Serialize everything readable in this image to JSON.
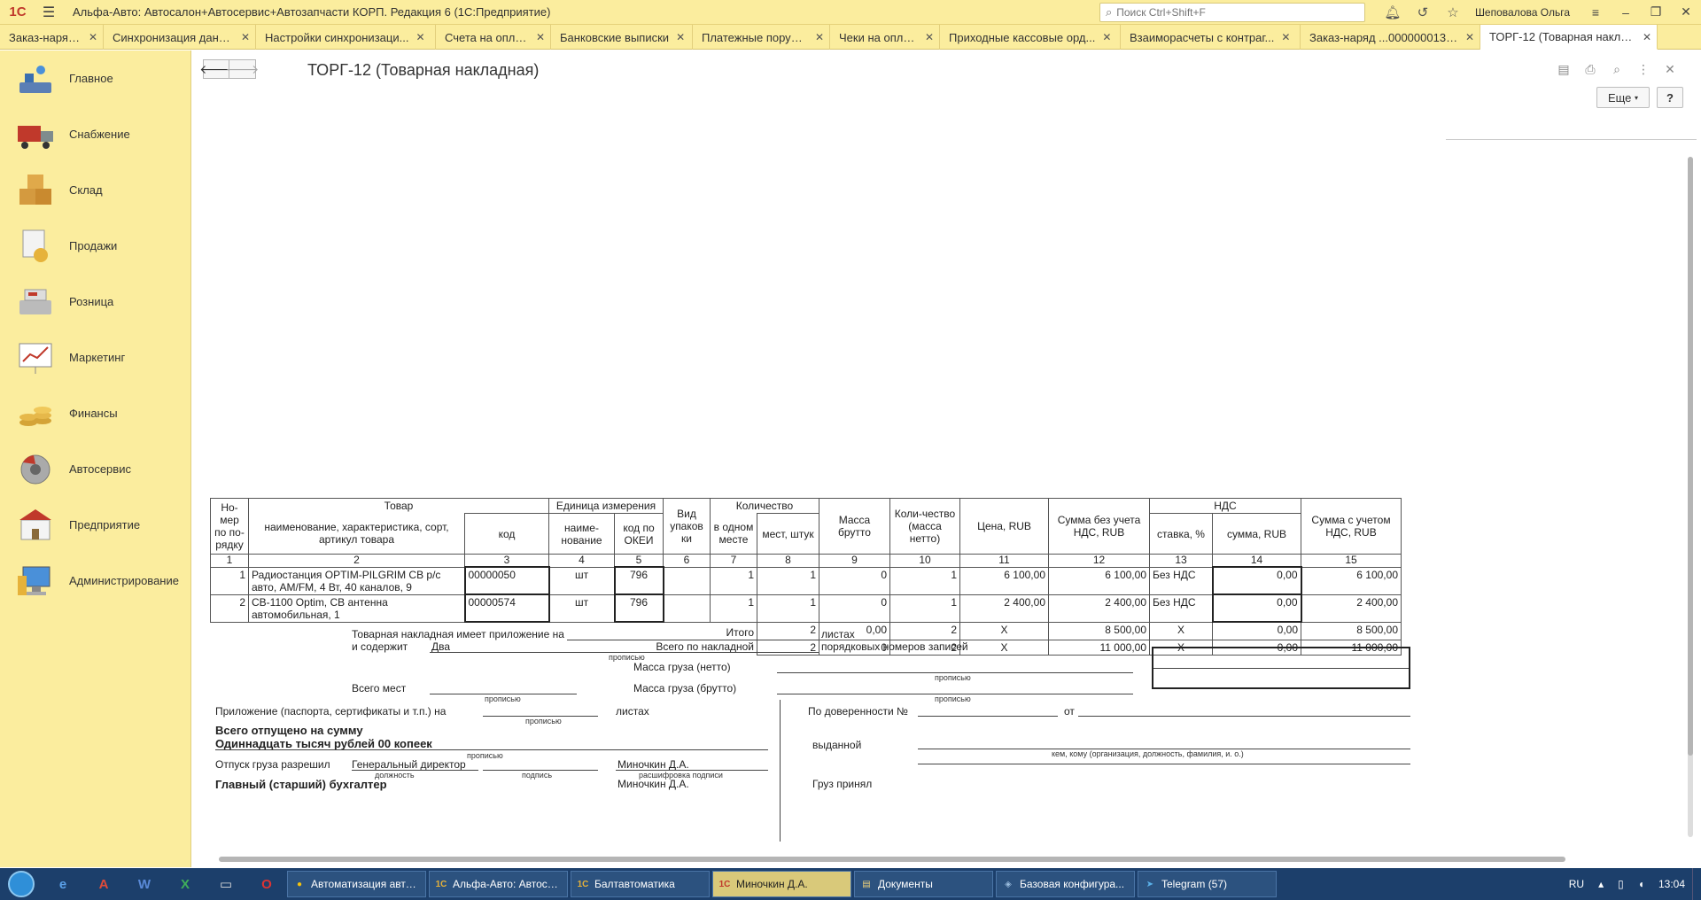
{
  "titlebar": {
    "logo": "1С",
    "title": "Альфа-Авто: Автосалон+Автосервис+Автозапчасти КОРП. Редакция 6  (1С:Предприятие)",
    "search_placeholder": "Поиск Ctrl+Shift+F",
    "user": "Шеповалова Ольга"
  },
  "tabs": [
    {
      "label": "Заказ-наряды"
    },
    {
      "label": "Синхронизация данных"
    },
    {
      "label": "Настройки синхронизаци..."
    },
    {
      "label": "Счета на оплату"
    },
    {
      "label": "Банковские выписки"
    },
    {
      "label": "Платежные поручения"
    },
    {
      "label": "Чеки на оплату"
    },
    {
      "label": "Приходные кассовые орд..."
    },
    {
      "label": "Взаиморасчеты с контраг..."
    },
    {
      "label": "Заказ-наряд ...00000001342"
    },
    {
      "label": "ТОРГ-12 (Товарная наклад..."
    }
  ],
  "sidebar": [
    {
      "label": "Главное"
    },
    {
      "label": "Снабжение"
    },
    {
      "label": "Склад"
    },
    {
      "label": "Продажи"
    },
    {
      "label": "Розница"
    },
    {
      "label": "Маркетинг"
    },
    {
      "label": "Финансы"
    },
    {
      "label": "Автосервис"
    },
    {
      "label": "Предприятие"
    },
    {
      "label": "Администрирование"
    }
  ],
  "main": {
    "title": "ТОРГ-12 (Товарная накладная)",
    "more_label": "Еще",
    "help_label": "?"
  },
  "invoice": {
    "h_num": "Но-мер по по-рядку",
    "h_goods": "Товар",
    "h_goods_name": "наименование, характеристика, сорт, артикул товара",
    "h_code": "код",
    "h_unit": "Единица измерения",
    "h_unit_name": "наиме-нование",
    "h_unit_okei": "код по ОКЕИ",
    "h_pack": "Вид упаков ки",
    "h_qty": "Количество",
    "h_qty_one": "в одном месте",
    "h_qty_pcs": "мест, штук",
    "h_gross": "Масса брутто",
    "h_net": "Коли-чество (масса нетто)",
    "h_price": "Цена, RUB",
    "h_sum_novat": "Сумма без учета НДС, RUB",
    "h_vat": "НДС",
    "h_vat_rate": "ставка, %",
    "h_vat_sum": "сумма, RUB",
    "h_sum_vat": "Сумма с учетом НДС, RUB",
    "col_numbers": [
      "1",
      "2",
      "3",
      "4",
      "5",
      "6",
      "7",
      "8",
      "9",
      "10",
      "11",
      "12",
      "13",
      "14",
      "15"
    ],
    "rows": [
      {
        "n": "1",
        "name": "Радиостанция OPTIM-PILGRIM CB р/с авто, AM/FM, 4 Вт, 40 каналов, 9",
        "code": "00000050",
        "unit": "шт",
        "okei": "796",
        "pack": "",
        "one": "1",
        "pcs": "1",
        "gross": "0",
        "net": "1",
        "price": "6 100,00",
        "sum": "6 100,00",
        "rate": "Без НДС",
        "vat": "0,00",
        "total": "6 100,00"
      },
      {
        "n": "2",
        "name": "CB-1100 Optim, CB антенна автомобильная, 1",
        "code": "00000574",
        "unit": "шт",
        "okei": "796",
        "pack": "",
        "one": "1",
        "pcs": "1",
        "gross": "0",
        "net": "1",
        "price": "2 400,00",
        "sum": "2 400,00",
        "rate": "Без НДС",
        "vat": "0,00",
        "total": "2 400,00"
      }
    ],
    "itogo": {
      "label": "Итого",
      "pcs": "2",
      "gross": "0,00",
      "net": "2",
      "price": "X",
      "sum": "8 500,00",
      "rate": "X",
      "vat": "0,00",
      "total": "8 500,00"
    },
    "vsego": {
      "label": "Всего по накладной",
      "pcs": "2",
      "gross": "0",
      "net": "2",
      "price": "X",
      "sum": "11 000,00",
      "rate": "X",
      "vat": "0,00",
      "total": "11 000,00"
    }
  },
  "footer": {
    "appendix1": "Товарная накладная имеет приложение на",
    "sheets": "листах",
    "contains": "и содержит",
    "records_value": "Два",
    "records": "порядковых номеров записей",
    "hint_words": "прописью",
    "net_mass": "Масса груза (нетто)",
    "total_places": "Всего мест",
    "gross_mass": "Масса груза (брутто)",
    "appendix2": "Приложение (паспорта, сертификаты и т.п.) на",
    "sheets2": "листах",
    "proxy": "По доверенности №",
    "from": "от",
    "released_sum": "Всего отпущено  на сумму",
    "sum_words": "Одиннадцать тысяч рублей 00 копеек",
    "issued": "выданной",
    "issued_hint": "кем, кому (организация, должность, фамилия, и. о.)",
    "release_allowed": "Отпуск груза разрешил",
    "director": "Генеральный директор",
    "director_name": "Миночкин Д.А.",
    "hint_position": "должность",
    "hint_signature": "подпись",
    "hint_decode": "расшифровка подписи",
    "chief_accountant": "Главный (старший) бухгалтер",
    "accountant_name": "Миночкин Д.А.",
    "received": "Груз принял"
  },
  "taskbar": {
    "tasks": [
      {
        "label": "Автоматизация авто...",
        "icon": "chrome-icon"
      },
      {
        "label": "Альфа-Авто: Автоса...",
        "icon": "1c-icon"
      },
      {
        "label": "Балтавтоматика",
        "icon": "1c-icon"
      },
      {
        "label": "Миночкин Д.А.",
        "icon": "1c-icon"
      },
      {
        "label": "Документы",
        "icon": "folder-icon"
      },
      {
        "label": "Базовая конфигура...",
        "icon": "app-icon"
      },
      {
        "label": "Telegram (57)",
        "icon": "telegram-icon"
      }
    ],
    "lang": "RU",
    "time": "13:04"
  }
}
